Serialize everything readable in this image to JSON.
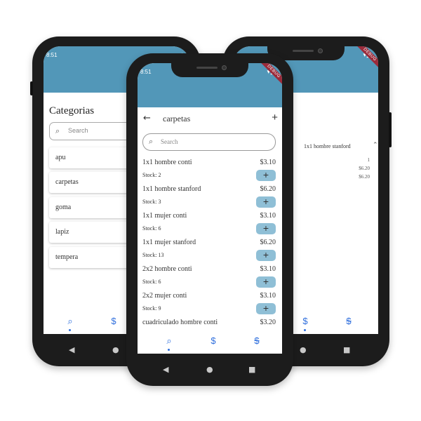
{
  "status": {
    "time": "8:51",
    "debug": "DEBUG"
  },
  "left": {
    "title": "Categorias",
    "search_placeholder": "Search",
    "categories": [
      "apu",
      "carpetas",
      "goma",
      "lapiz",
      "tempera"
    ]
  },
  "center": {
    "title": "carpetas",
    "search_placeholder": "Search",
    "products": [
      {
        "name": "1x1 hombre conti",
        "price": "$3.10",
        "stock": "Stock: 2"
      },
      {
        "name": "1x1 hombre stanford",
        "price": "$6.20",
        "stock": "Stock: 3"
      },
      {
        "name": "1x1 mujer conti",
        "price": "$3.10",
        "stock": "Stock: 6"
      },
      {
        "name": "1x1 mujer stanford",
        "price": "$6.20",
        "stock": "Stock: 13"
      },
      {
        "name": "2x2 hombre conti",
        "price": "$3.10",
        "stock": "Stock: 6"
      },
      {
        "name": "2x2 mujer conti",
        "price": "$3.10",
        "stock": "Stock: 9"
      },
      {
        "name": "cuadriculado hombre conti",
        "price": "$3.20",
        "stock": ""
      }
    ]
  },
  "right": {
    "product": "1x1 hombre stanford",
    "details": [
      "1",
      "$6.20",
      "$6.20"
    ]
  },
  "nav": {
    "search_icon": "search-icon",
    "dollar_icon": "dollar-icon",
    "no_dollar_icon": "money-off-icon"
  },
  "colors": {
    "appbar": "#5297b8",
    "accent": "#2f6fdd",
    "add_button": "#8fbfd6"
  }
}
